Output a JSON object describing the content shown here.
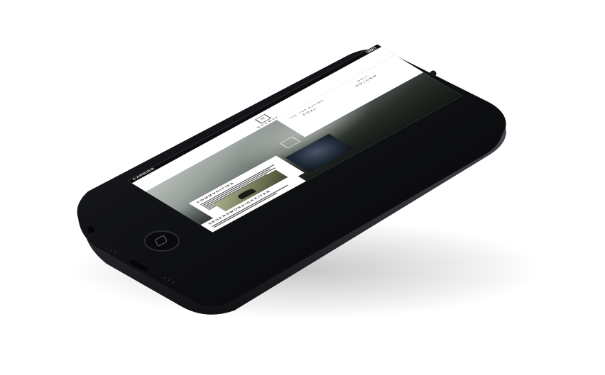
{
  "phone": {
    "status_bar": {
      "carrier": "CARRIER"
    }
  },
  "website": {
    "header": {
      "logo_text": "N",
      "brand": "NORWAY"
    },
    "info": [
      {
        "label": "THE TOP RATING",
        "value": "FOAL"
      },
      {
        "label": "ONLY",
        "value": "HOLDEN"
      }
    ],
    "cards": [
      {
        "title": "COMMUNITIES"
      },
      {
        "title": "SEHENSWÜRDIGKEITEN"
      }
    ]
  }
}
